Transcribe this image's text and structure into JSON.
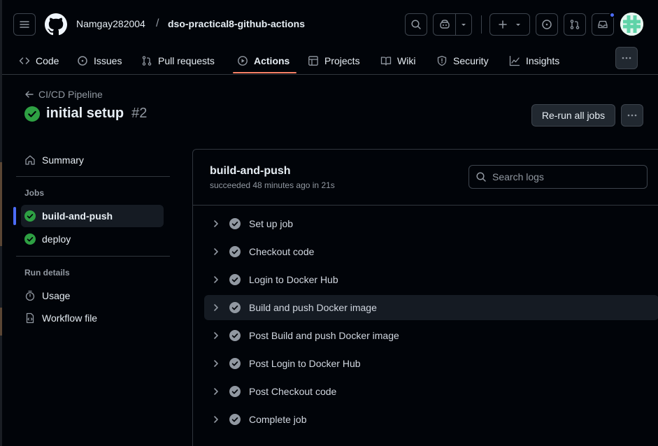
{
  "header": {
    "owner": "Namgay282004",
    "separator": "/",
    "repo": "dso-practical8-github-actions"
  },
  "tabs": [
    {
      "label": "Code",
      "icon": "code-icon"
    },
    {
      "label": "Issues",
      "icon": "issue-opened-icon"
    },
    {
      "label": "Pull requests",
      "icon": "git-pull-request-icon"
    },
    {
      "label": "Actions",
      "icon": "play-icon",
      "active": true
    },
    {
      "label": "Projects",
      "icon": "table-icon"
    },
    {
      "label": "Wiki",
      "icon": "book-icon"
    },
    {
      "label": "Security",
      "icon": "shield-icon"
    },
    {
      "label": "Insights",
      "icon": "graph-icon"
    }
  ],
  "run": {
    "workflow": "CI/CD Pipeline",
    "title": "initial setup",
    "number": "#2",
    "rerun_label": "Re-run all jobs",
    "status": "success"
  },
  "sidebar": {
    "summary": "Summary",
    "jobs_heading": "Jobs",
    "jobs": [
      "build-and-push",
      "deploy"
    ],
    "run_details_heading": "Run details",
    "usage": "Usage",
    "workflow_file": "Workflow file"
  },
  "job": {
    "name": "build-and-push",
    "meta": "succeeded 48 minutes ago in 21s",
    "search_placeholder": "Search logs",
    "steps": [
      "Set up job",
      "Checkout code",
      "Login to Docker Hub",
      "Build and push Docker image",
      "Post Build and push Docker image",
      "Post Login to Docker Hub",
      "Post Checkout code",
      "Complete job"
    ]
  },
  "colors": {
    "background": "#010409",
    "success": "#2ea043",
    "accent_underline": "#f78166",
    "selection_bar": "#4c6cf5",
    "border": "#30363d"
  }
}
